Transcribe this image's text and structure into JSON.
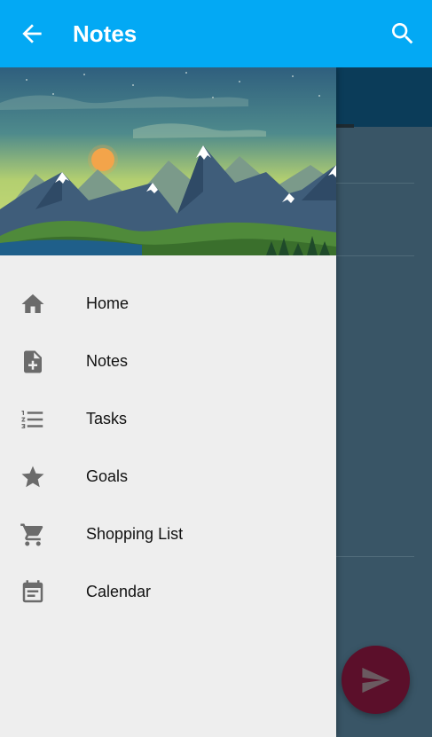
{
  "appbar": {
    "title": "Notes",
    "back_icon": "arrow-back-icon",
    "search_icon": "search-icon",
    "color": "#03A9F4"
  },
  "drawer": {
    "header_image": "mountain-landscape",
    "items": [
      {
        "label": "Home",
        "icon": "home-icon"
      },
      {
        "label": "Notes",
        "icon": "note-add-icon"
      },
      {
        "label": "Tasks",
        "icon": "list-icon"
      },
      {
        "label": "Goals",
        "icon": "star-icon"
      },
      {
        "label": "Shopping List",
        "icon": "cart-icon"
      },
      {
        "label": "Calendar",
        "icon": "calendar-icon"
      }
    ]
  },
  "fab": {
    "icon": "send-icon",
    "color": "#5b0f2a"
  }
}
